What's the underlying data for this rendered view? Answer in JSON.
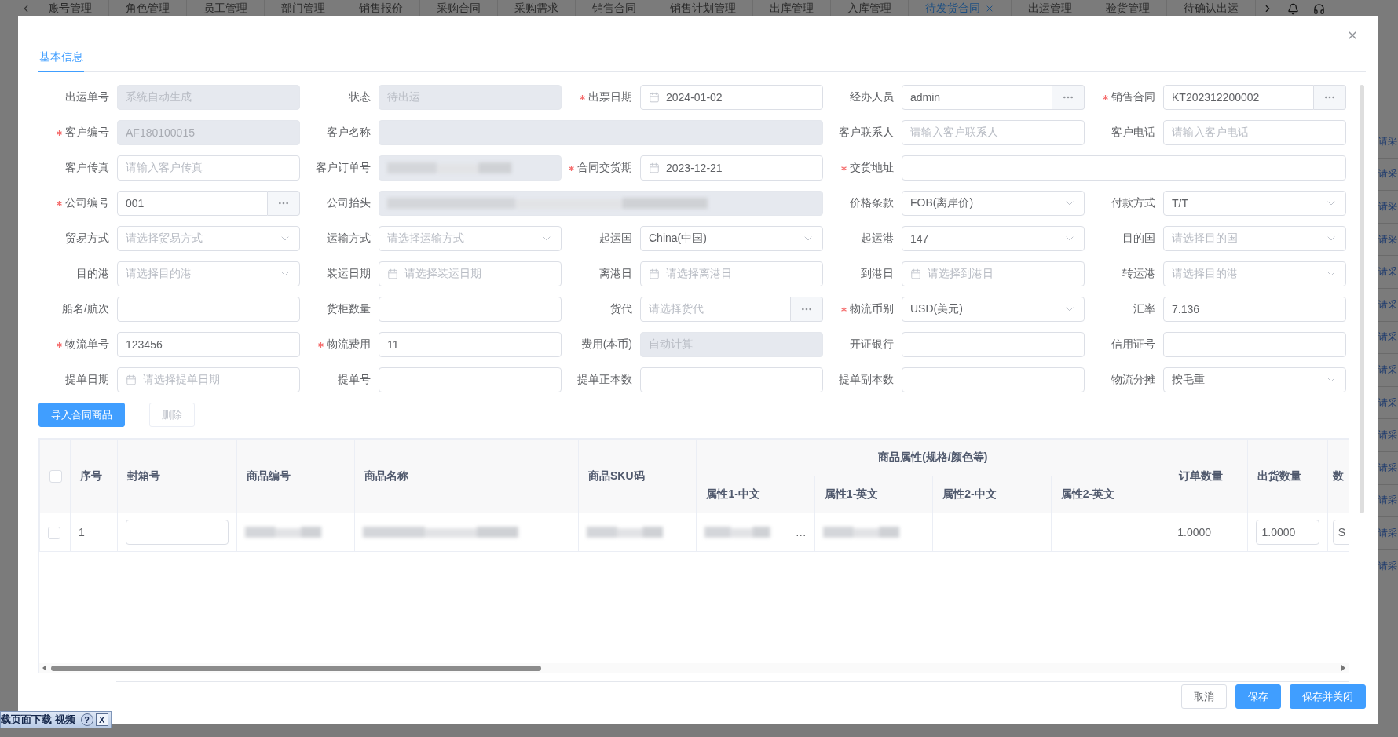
{
  "top_tabs": [
    {
      "label": "账号管理",
      "selected": false,
      "closable": false
    },
    {
      "label": "角色管理",
      "selected": false,
      "closable": false
    },
    {
      "label": "员工管理",
      "selected": false,
      "closable": false
    },
    {
      "label": "部门管理",
      "selected": false,
      "closable": false
    },
    {
      "label": "销售报价",
      "selected": false,
      "closable": false
    },
    {
      "label": "采购合同",
      "selected": false,
      "closable": false
    },
    {
      "label": "采购需求",
      "selected": false,
      "closable": false
    },
    {
      "label": "销售合同",
      "selected": false,
      "closable": false
    },
    {
      "label": "销售计划管理",
      "selected": false,
      "closable": false
    },
    {
      "label": "出库管理",
      "selected": false,
      "closable": false
    },
    {
      "label": "入库管理",
      "selected": false,
      "closable": false
    },
    {
      "label": "待发货合同",
      "selected": true,
      "closable": true
    },
    {
      "label": "出运管理",
      "selected": false,
      "closable": false
    },
    {
      "label": "验货管理",
      "selected": false,
      "closable": false
    },
    {
      "label": "待确认出运",
      "selected": false,
      "closable": false
    }
  ],
  "background_links": [
    "请采",
    "请采",
    "请采",
    "请采",
    "请采",
    "请采",
    "请采",
    "请采",
    "请采",
    "请采",
    "请采",
    "请采",
    "请采",
    "请采"
  ],
  "dialog": {
    "tabs": [
      {
        "label": "基本信息",
        "selected": true
      }
    ],
    "fields": [
      {
        "label": "出运单号",
        "required": false,
        "kind": "text",
        "placeholder": "系统自动生成",
        "disabled": true
      },
      {
        "label": "状态",
        "required": false,
        "kind": "text",
        "placeholder": "待出运",
        "disabled": true
      },
      {
        "label": "出票日期",
        "required": true,
        "kind": "date",
        "value": "2024-01-02",
        "disabled": false
      },
      {
        "label": "经办人员",
        "required": false,
        "kind": "lookup",
        "value": "admin",
        "disabled": false
      },
      {
        "label": "销售合同",
        "required": true,
        "kind": "lookup",
        "value": "KT202312200002",
        "disabled": false
      },
      {
        "label": "客户编号",
        "required": true,
        "kind": "text",
        "value": "AF180100015",
        "disabled": true
      },
      {
        "label": "客户名称",
        "required": false,
        "kind": "text",
        "disabled": true,
        "wide": true
      },
      {
        "label": "客户联系人",
        "required": false,
        "kind": "text",
        "placeholder": "请输入客户联系人",
        "disabled": false
      },
      {
        "label": "客户电话",
        "required": false,
        "kind": "text",
        "placeholder": "请输入客户电话",
        "disabled": false
      },
      {
        "label": "客户传真",
        "required": false,
        "kind": "text",
        "placeholder": "请输入客户传真",
        "disabled": false
      },
      {
        "label": "客户订单号",
        "required": false,
        "kind": "text",
        "disabled": true,
        "blurred": true
      },
      {
        "label": "合同交货期",
        "required": true,
        "kind": "date",
        "value": "2023-12-21",
        "disabled": false
      },
      {
        "label": "交货地址",
        "required": true,
        "kind": "text",
        "disabled": false,
        "wide": true
      },
      {
        "label": "公司编号",
        "required": true,
        "kind": "lookup",
        "value": "001",
        "disabled": false
      },
      {
        "label": "公司抬头",
        "required": false,
        "kind": "text",
        "disabled": true,
        "wide": true,
        "blurred": true
      },
      {
        "label": "价格条款",
        "required": false,
        "kind": "select",
        "value": "FOB(离岸价)",
        "disabled": false
      },
      {
        "label": "付款方式",
        "required": false,
        "kind": "select",
        "value": "T/T",
        "disabled": false
      },
      {
        "label": "贸易方式",
        "required": false,
        "kind": "select",
        "placeholder": "请选择贸易方式",
        "disabled": false
      },
      {
        "label": "运输方式",
        "required": false,
        "kind": "select",
        "placeholder": "请选择运输方式",
        "disabled": false
      },
      {
        "label": "起运国",
        "required": false,
        "kind": "select",
        "value": "China(中国)",
        "disabled": false
      },
      {
        "label": "起运港",
        "required": false,
        "kind": "select",
        "value": "147",
        "disabled": false
      },
      {
        "label": "目的国",
        "required": false,
        "kind": "select",
        "placeholder": "请选择目的国",
        "disabled": false
      },
      {
        "label": "目的港",
        "required": false,
        "kind": "select",
        "placeholder": "请选择目的港",
        "disabled": false
      },
      {
        "label": "装运日期",
        "required": false,
        "kind": "date",
        "placeholder": "请选择装运日期",
        "disabled": false
      },
      {
        "label": "离港日",
        "required": false,
        "kind": "date",
        "placeholder": "请选择离港日",
        "disabled": false
      },
      {
        "label": "到港日",
        "required": false,
        "kind": "date",
        "placeholder": "请选择到港日",
        "disabled": false
      },
      {
        "label": "转运港",
        "required": false,
        "kind": "select",
        "placeholder": "请选择目的港",
        "disabled": false
      },
      {
        "label": "船名/航次",
        "required": false,
        "kind": "text",
        "disabled": false
      },
      {
        "label": "货柜数量",
        "required": false,
        "kind": "text",
        "disabled": false
      },
      {
        "label": "货代",
        "required": false,
        "kind": "lookup",
        "placeholder": "请选择货代",
        "disabled": false
      },
      {
        "label": "物流币别",
        "required": true,
        "kind": "select",
        "value": "USD(美元)",
        "disabled": false
      },
      {
        "label": "汇率",
        "required": false,
        "kind": "text",
        "value": "7.136",
        "disabled": false
      },
      {
        "label": "物流单号",
        "required": true,
        "kind": "text",
        "value": "123456",
        "disabled": false
      },
      {
        "label": "物流费用",
        "required": true,
        "kind": "text",
        "value": "11",
        "disabled": false
      },
      {
        "label": "费用(本币)",
        "required": false,
        "kind": "text",
        "placeholder": "自动计算",
        "disabled": true
      },
      {
        "label": "开证银行",
        "required": false,
        "kind": "text",
        "disabled": false
      },
      {
        "label": "信用证号",
        "required": false,
        "kind": "text",
        "disabled": false
      },
      {
        "label": "提单日期",
        "required": false,
        "kind": "date",
        "placeholder": "请选择提单日期",
        "disabled": false
      },
      {
        "label": "提单号",
        "required": false,
        "kind": "text",
        "disabled": false
      },
      {
        "label": "提单正本数",
        "required": false,
        "kind": "text",
        "disabled": false
      },
      {
        "label": "提单副本数",
        "required": false,
        "kind": "text",
        "disabled": false
      },
      {
        "label": "物流分摊",
        "required": false,
        "kind": "select",
        "value": "按毛重",
        "disabled": false
      }
    ],
    "actions": [
      {
        "label": "导入合同商品",
        "kind": "primary",
        "disabled": false
      },
      {
        "label": "删除",
        "kind": "default",
        "disabled": true
      }
    ],
    "table": {
      "columns": [
        {
          "kind": "checkbox",
          "checked": false
        },
        {
          "kind": "text",
          "label": "序号"
        },
        {
          "kind": "text",
          "label": "封箱号"
        },
        {
          "kind": "text",
          "label": "商品编号"
        },
        {
          "kind": "text",
          "label": "商品名称"
        },
        {
          "kind": "text",
          "label": "商品SKU码"
        },
        {
          "kind": "group",
          "label": "商品属性(规格/颜色等)",
          "children": [
            {
              "label": "属性1-中文"
            },
            {
              "label": "属性1-英文"
            },
            {
              "label": "属性2-中文"
            },
            {
              "label": "属性2-英文"
            }
          ]
        },
        {
          "kind": "text",
          "label": "订单数量"
        },
        {
          "kind": "text",
          "label": "出货数量"
        },
        {
          "kind": "text",
          "label": "数"
        }
      ],
      "rows": [
        {
          "cells": [
            {
              "kind": "checkbox",
              "checked": false
            },
            {
              "kind": "text",
              "text": "1"
            },
            {
              "kind": "input"
            },
            {
              "kind": "blurred"
            },
            {
              "kind": "blurred"
            },
            {
              "kind": "blurred"
            },
            {
              "kind": "blurred",
              "text": "…"
            },
            {
              "kind": "blurred"
            },
            {
              "kind": "empty"
            },
            {
              "kind": "empty"
            },
            {
              "kind": "text",
              "text": "1.0000"
            },
            {
              "kind": "input",
              "value": "1.0000"
            },
            {
              "kind": "input",
              "value": "S"
            }
          ]
        }
      ]
    },
    "footer_buttons": [
      {
        "label": "取消",
        "kind": "default",
        "disabled": false
      },
      {
        "label": "保存",
        "kind": "primary",
        "disabled": false
      },
      {
        "label": "保存并关闭",
        "kind": "primary",
        "disabled": false
      }
    ]
  },
  "floating_toolbar": {
    "label": "载页面下载 视频",
    "buttons": [
      {
        "kind": "help",
        "label": "?"
      },
      {
        "kind": "close",
        "label": "X"
      }
    ]
  }
}
